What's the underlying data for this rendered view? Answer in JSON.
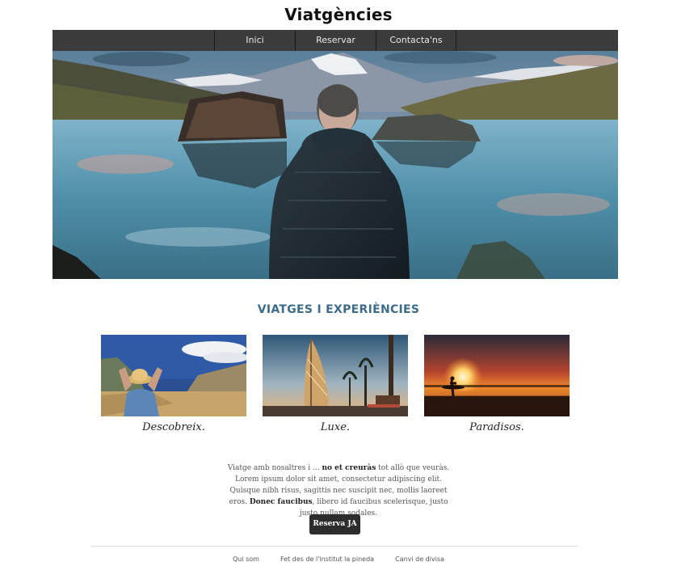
{
  "site": {
    "title": "Viatgències"
  },
  "nav": {
    "items": [
      {
        "label": "Inici"
      },
      {
        "label": "Reservar"
      },
      {
        "label": "Contacta'ns"
      }
    ]
  },
  "section": {
    "title": "VIATGES I EXPERIÈNCIES"
  },
  "cards": [
    {
      "caption": "Descobreix."
    },
    {
      "caption": "Luxe."
    },
    {
      "caption": "Paradisos."
    }
  ],
  "intro": {
    "part1": "Viatge amb nosaltres i ... ",
    "bold1": "no et creuràs",
    "part2": " tot allò que veuràs. Lorem ipsum dolor sit amet, consectetur adipiscing elit. Quisque nibh risus, sagittis nec suscipit nec, mollis laoreet eros. ",
    "bold2": "Donec faucibus",
    "part3": ", libero id faucibus scelerisque, justo justo nullam sodales."
  },
  "cta": {
    "label": "Reserva JA"
  },
  "footer": {
    "links": [
      {
        "label": "Qui som"
      },
      {
        "label": "Fet des de l'institut la pineda"
      },
      {
        "label": "Canvi de divisa"
      }
    ]
  },
  "colors": {
    "nav_bg": "#3b3b3b",
    "section_title": "#3d6c8a",
    "cta_bg": "#2d2d2d"
  },
  "images": {
    "hero": "man-in-jacket-looking-at-mountain-lake",
    "card1": "hiker-with-hat-on-coastal-hill",
    "card2": "luxury-sail-shaped-hotel-at-sunset",
    "card3": "surfer-silhouette-on-beach-at-sunset"
  }
}
